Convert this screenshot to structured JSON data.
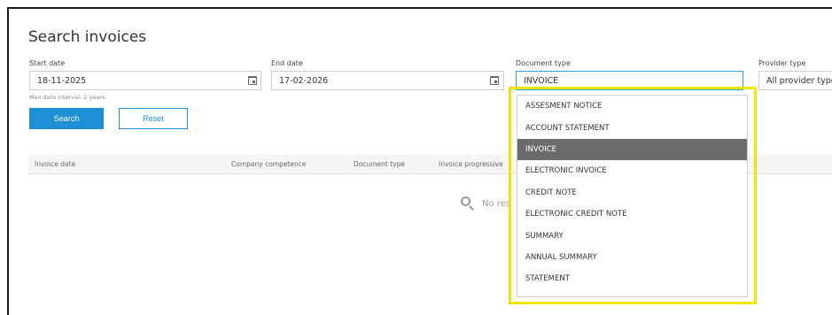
{
  "page": {
    "title": "Search invoices"
  },
  "filters": {
    "start_date": {
      "label": "Start date",
      "value": "18-11-2025"
    },
    "end_date": {
      "label": "End date",
      "value": "17-02-2026"
    },
    "document_type": {
      "label": "Document type",
      "value": "INVOICE"
    },
    "provider_type": {
      "label": "Provider type",
      "value": "All provider types"
    },
    "hint": "Max date interval: 2 years."
  },
  "buttons": {
    "search": "Search",
    "reset": "Reset"
  },
  "table": {
    "columns": [
      "Invoice date",
      "Company competence",
      "Document type",
      "Invoice progressive"
    ],
    "empty_text": "No res"
  },
  "dropdown": {
    "options": [
      "ASSESMENT NOTICE",
      "ACCOUNT STATEMENT",
      "INVOICE",
      "ELECTRONIC INVOICE",
      "CREDIT NOTE",
      "ELECTRONIC CREDIT NOTE",
      "SUMMARY",
      "ANNUAL SUMMARY",
      "STATEMENT"
    ],
    "selected_index": 2,
    "highlight_color": "#f2e600"
  },
  "colors": {
    "accent": "#1f8fd6",
    "focus": "#29a3e0",
    "selected_bg": "#6b6b6b"
  }
}
